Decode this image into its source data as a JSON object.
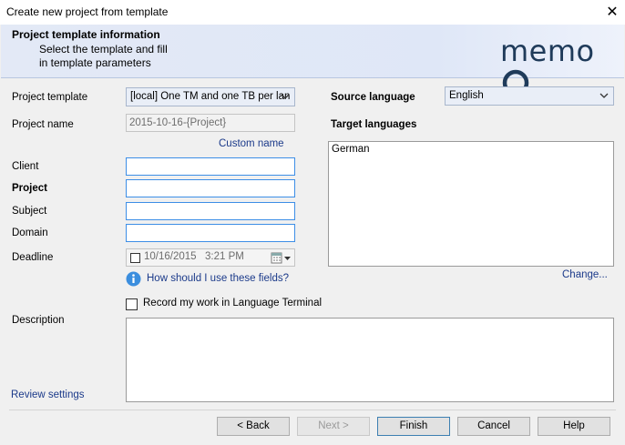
{
  "window": {
    "title": "Create new project from template",
    "close_glyph": "✕"
  },
  "header": {
    "title": "Project template information",
    "subtitle_line1": "Select the template and fill",
    "subtitle_line2": "in template parameters",
    "logo_text": "memo"
  },
  "form": {
    "project_template_label": "Project template",
    "project_template_value": "[local] One TM and one TB per lan",
    "project_name_label": "Project name",
    "project_name_value": "2015-10-16-{Project}",
    "custom_name_link": "Custom name",
    "client_label": "Client",
    "project_label": "Project",
    "subject_label": "Subject",
    "domain_label": "Domain",
    "deadline_label": "Deadline",
    "deadline_date": "10/16/2015",
    "deadline_time": "3:21 PM",
    "help_link": "How should I use these fields?",
    "record_checkbox_label": "Record my work in Language Terminal",
    "description_label": "Description",
    "review_settings_link": "Review settings"
  },
  "languages": {
    "source_label": "Source language",
    "source_value": "English",
    "target_label": "Target languages",
    "targets": [
      "German"
    ],
    "change_link": "Change..."
  },
  "buttons": {
    "back": "< Back",
    "next": "Next >",
    "finish": "Finish",
    "cancel": "Cancel",
    "help": "Help"
  },
  "colors": {
    "accent_blue": "#3d8ee6",
    "link_blue": "#1b3a8a",
    "logo_red": "#cc1f26"
  },
  "icons": {
    "info": "info-icon",
    "calendar": "calendar-icon",
    "dropdown": "chevron-down-icon",
    "close": "close-icon"
  }
}
